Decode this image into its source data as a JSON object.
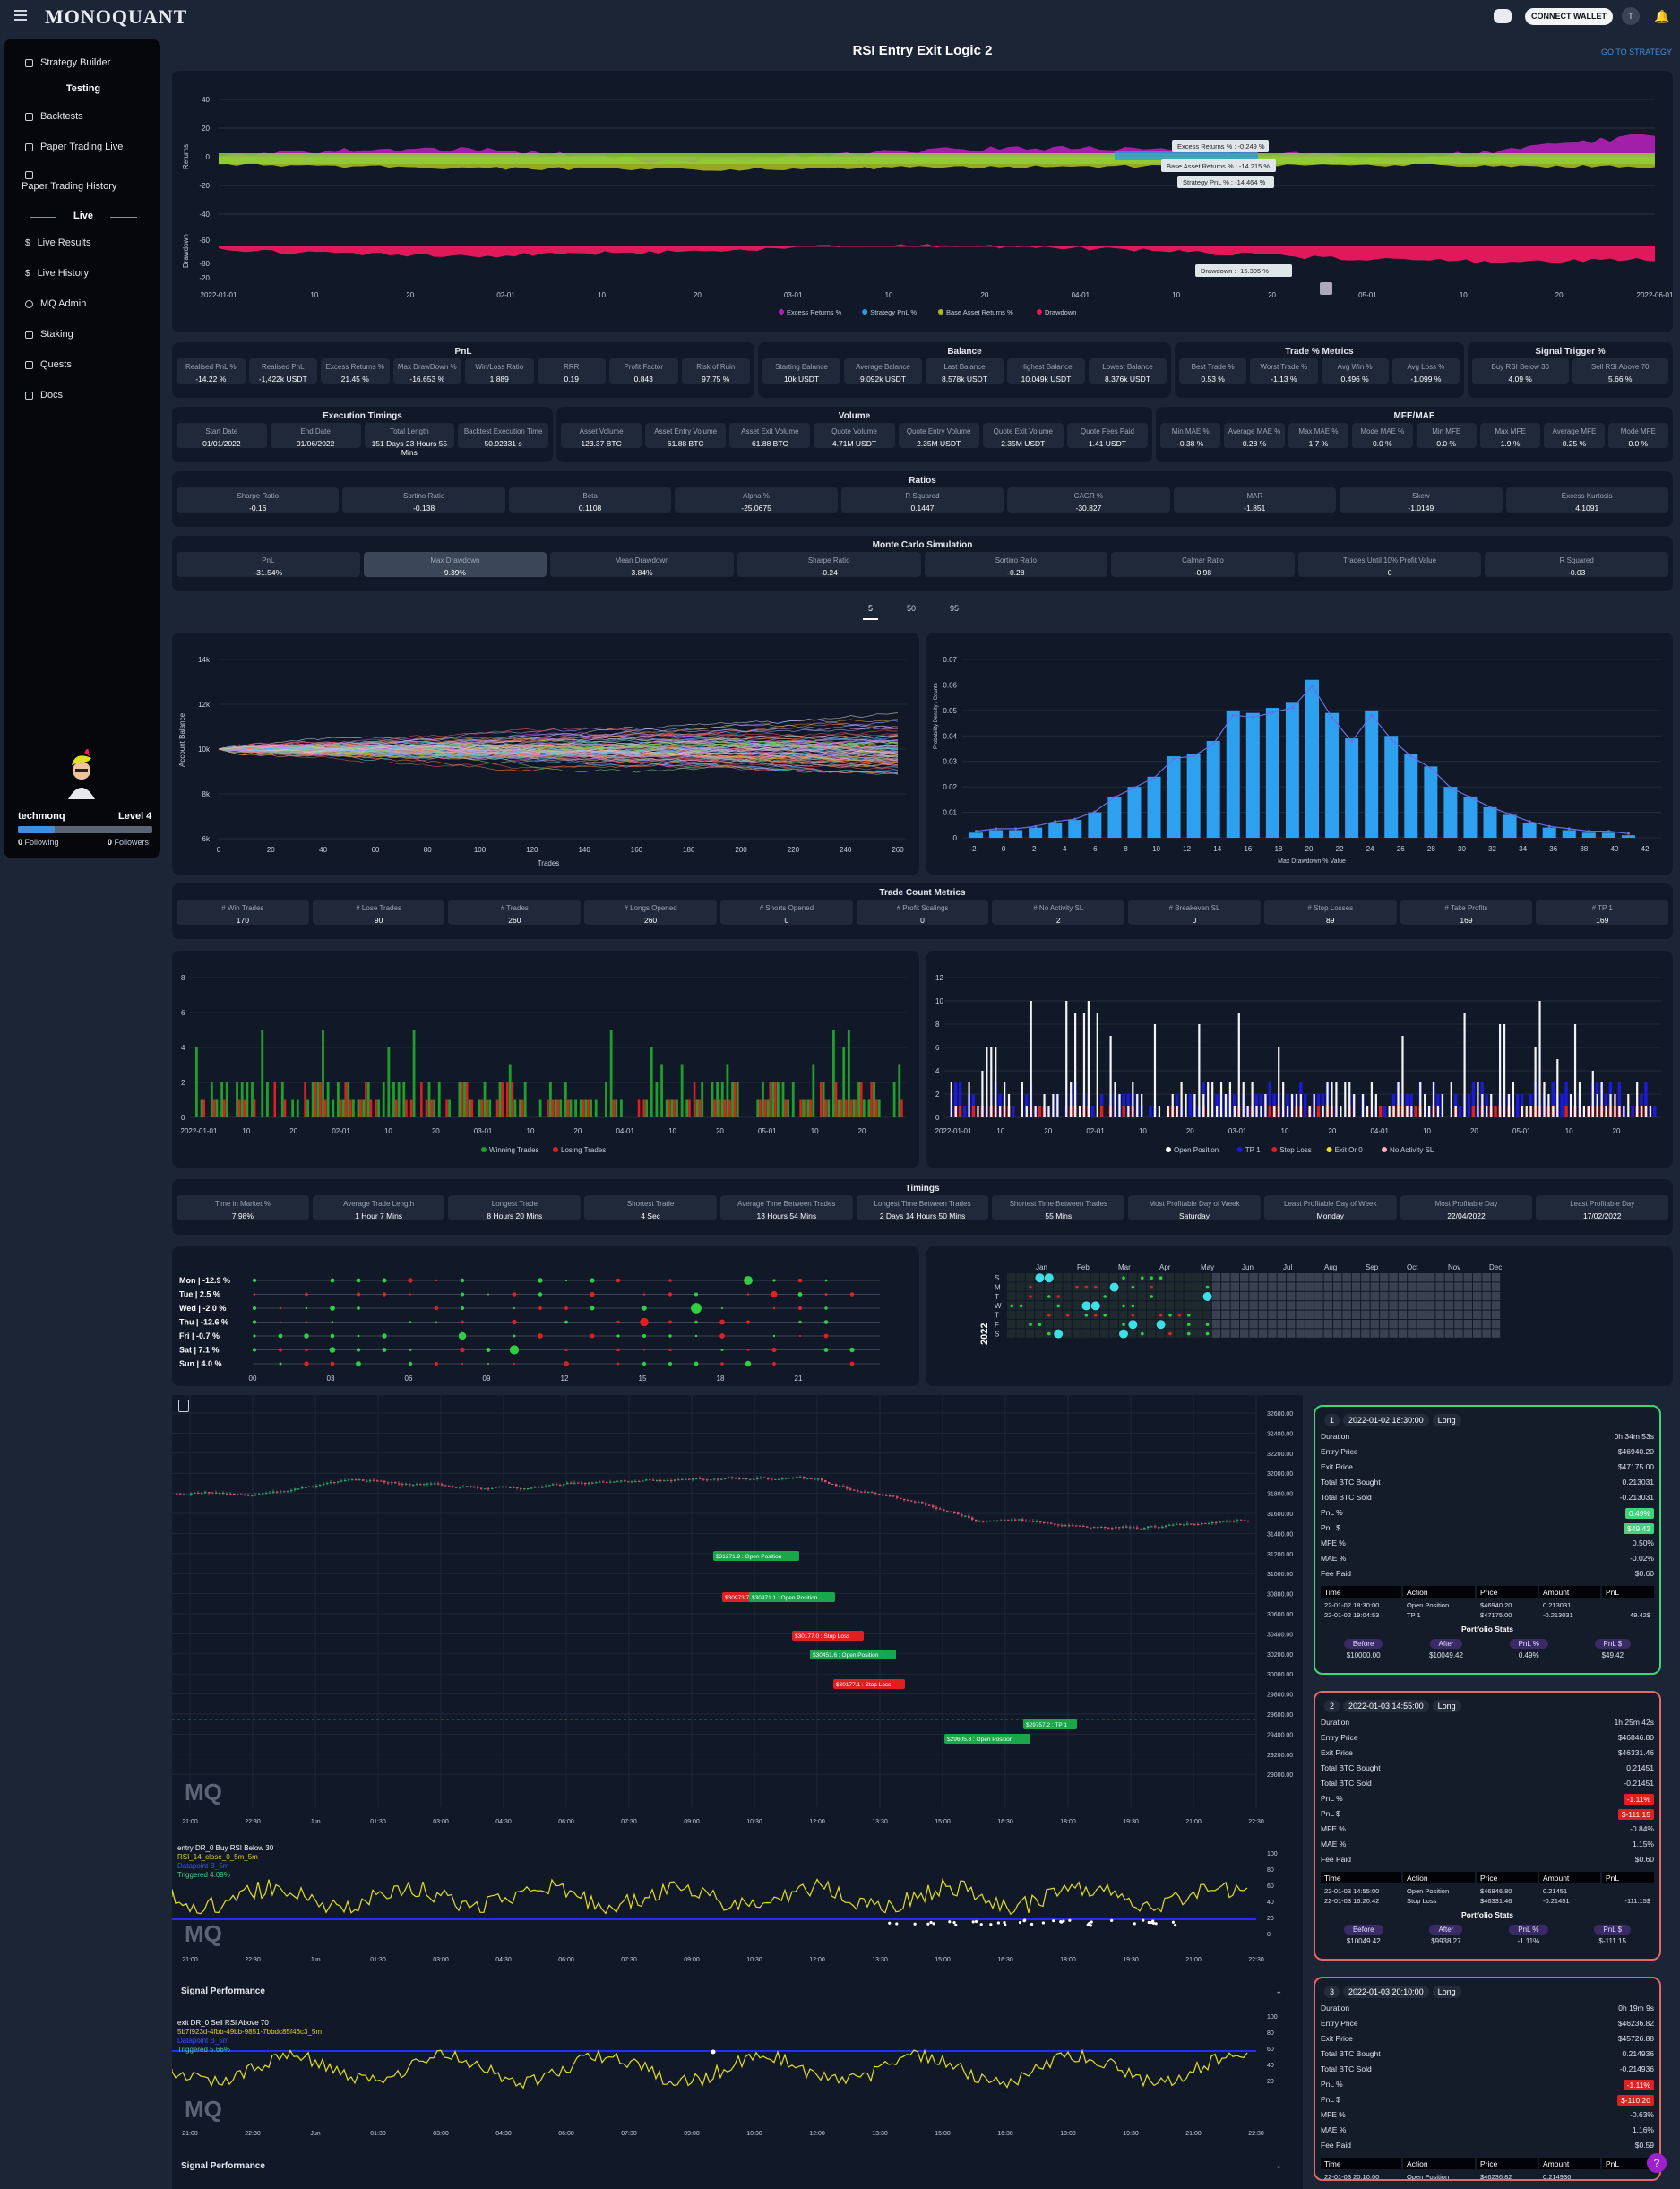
{
  "app": {
    "logo": "MONOQUANT",
    "connect": "CONNECT WALLET",
    "avatar": "T"
  },
  "sidebar": {
    "items": [
      "Strategy Builder",
      "Backtests",
      "Paper Trading Live",
      "Paper Trading History",
      "Live Results",
      "Live History",
      "MQ Admin",
      "Staking",
      "Quests",
      "Docs"
    ],
    "testing": "Testing",
    "live": "Live",
    "user": "techmonq",
    "level": "Level 4",
    "following": "0",
    "following_lbl": "Following",
    "followers": "0",
    "followers_lbl": "Followers",
    "level_progress": 0.27
  },
  "page": {
    "title": "RSI Entry Exit Logic 2",
    "goto": "GO TO STRATEGY"
  },
  "returns_chart": {
    "y_ticks": [
      "40",
      "20",
      "0",
      "-20",
      "-40"
    ],
    "dd_ticks": [
      "-60",
      "-80",
      "-20"
    ],
    "ylabel": "Returns",
    "ddlabel": "Drawdown",
    "x_ticks": [
      "2022-01-01",
      "10",
      "20",
      "02-01",
      "10",
      "20",
      "03-01",
      "10",
      "20",
      "04-01",
      "10",
      "20",
      "05-01",
      "10",
      "20",
      "2022-06-01"
    ],
    "tooltips": [
      "Excess Returns % : -0.249 %",
      "Base Asset Returns % : -14.215 %",
      "Strategy PnL % : -14.464 %",
      "Drawdown : -15.305 %"
    ],
    "legend": [
      "Excess Returns %",
      "Strategy PnL %",
      "Base Asset Returns %",
      "Drawdown"
    ],
    "colors": {
      "excess": "#b320b8",
      "strategy": "#2a9bd8",
      "base": "#a7b821",
      "drawdown": "#e0195a"
    }
  },
  "pnl": {
    "title": "PnL",
    "cards": [
      [
        "Realised PnL %",
        "-14.22 %"
      ],
      [
        "Realised PnL",
        "-1,422k USDT"
      ],
      [
        "Excess Returns %",
        "21.45 %"
      ],
      [
        "Max DrawDown %",
        "-16.653 %"
      ],
      [
        "Win/Loss Ratio",
        "1.889"
      ],
      [
        "RRR",
        "0.19"
      ],
      [
        "Profit Factor",
        "0.843"
      ],
      [
        "Risk of Ruin",
        "97.75 %"
      ]
    ]
  },
  "balance": {
    "title": "Balance",
    "cards": [
      [
        "Starting Balance",
        "10k USDT"
      ],
      [
        "Average Balance",
        "9.092k USDT"
      ],
      [
        "Last Balance",
        "8.578k USDT"
      ],
      [
        "Highest Balance",
        "10.049k USDT"
      ],
      [
        "Lowest Balance",
        "8.376k USDT"
      ]
    ]
  },
  "trade_pct": {
    "title": "Trade % Metrics",
    "cards": [
      [
        "Best Trade %",
        "0.53 %"
      ],
      [
        "Worst Trade %",
        "-1.13 %"
      ],
      [
        "Avg Win %",
        "0.496 %"
      ],
      [
        "Avg Loss %",
        "-1.099 %"
      ]
    ]
  },
  "signal_trigger": {
    "title": "Signal Trigger %",
    "cards": [
      [
        "Buy RSI Below 30",
        "4.09 %"
      ],
      [
        "Sell RSI Above 70",
        "5.66 %"
      ]
    ]
  },
  "exec": {
    "title": "Execution Timings",
    "cards": [
      [
        "Start Date",
        "01/01/2022"
      ],
      [
        "End Date",
        "01/06/2022"
      ],
      [
        "Total Length",
        "151 Days 23 Hours 55 Mins"
      ],
      [
        "Backtest Execution Time",
        "50.92331 s"
      ]
    ]
  },
  "volume": {
    "title": "Volume",
    "cards": [
      [
        "Asset Volume",
        "123.37 BTC"
      ],
      [
        "Asset Entry Volume",
        "61.88 BTC"
      ],
      [
        "Asset Exit Volume",
        "61.88 BTC"
      ],
      [
        "Quote Volume",
        "4.71M USDT"
      ],
      [
        "Quote Entry Volume",
        "2.35M USDT"
      ],
      [
        "Quote Exit Volume",
        "2.35M USDT"
      ],
      [
        "Quote Fees Paid",
        "1.41 USDT"
      ]
    ]
  },
  "mfe": {
    "title": "MFE/MAE",
    "cards": [
      [
        "Min MAE %",
        "-0.38 %"
      ],
      [
        "Average MAE %",
        "0.28 %"
      ],
      [
        "Max MAE %",
        "1.7 %"
      ],
      [
        "Mode MAE %",
        "0.0 %"
      ],
      [
        "Min MFE",
        "0.0 %"
      ],
      [
        "Max MFE",
        "1.9 %"
      ],
      [
        "Average MFE",
        "0.25 %"
      ],
      [
        "Mode MFE",
        "0.0 %"
      ]
    ]
  },
  "ratios": {
    "title": "Ratios",
    "cards": [
      [
        "Sharpe Ratio",
        "-0.16"
      ],
      [
        "Sortino Ratio",
        "-0.138"
      ],
      [
        "Beta",
        "0.1108"
      ],
      [
        "Alpha %",
        "-25.0675"
      ],
      [
        "R Squared",
        "0.1447"
      ],
      [
        "CAGR %",
        "-30.827"
      ],
      [
        "MAR",
        "-1.851"
      ],
      [
        "Skew",
        "-1.0149"
      ],
      [
        "Excess Kurtosis",
        "4.1091"
      ]
    ]
  },
  "monte": {
    "title": "Monte Carlo Simulation",
    "cards": [
      [
        "PnL",
        "-31.54%"
      ],
      [
        "Max Drawdown",
        "9.39%"
      ],
      [
        "Mean Drawdown",
        "3.84%"
      ],
      [
        "Sharpe Ratio",
        "-0.24"
      ],
      [
        "Sortino Ratio",
        "-0.28"
      ],
      [
        "Calmar Ratio",
        "-0.98"
      ],
      [
        "Trades Until 10% Profit Value",
        "0"
      ],
      [
        "R Squared",
        "-0.03"
      ]
    ],
    "tabs": [
      "5",
      "50",
      "95"
    ]
  },
  "mc_lines": {
    "y_ticks": [
      "14k",
      "12k",
      "10k",
      "8k",
      "6k"
    ],
    "x_ticks": [
      "0",
      "20",
      "40",
      "60",
      "80",
      "100",
      "120",
      "140",
      "160",
      "180",
      "200",
      "220",
      "240",
      "260"
    ],
    "ylabel": "Account Balance",
    "xlabel": "Trades"
  },
  "mc_hist": {
    "y_ticks": [
      "0.07",
      "0.06",
      "0.05",
      "0.04",
      "0.03",
      "0.02",
      "0.01",
      "0"
    ],
    "x_ticks": [
      "-2",
      "0",
      "2",
      "4",
      "6",
      "8",
      "10",
      "12",
      "14",
      "16",
      "18",
      "20",
      "22",
      "24",
      "26",
      "28",
      "30",
      "32",
      "34",
      "36",
      "38",
      "40",
      "42"
    ],
    "ylabel": "Probability Density / Counts",
    "xlabel": "Max Drawdown % Value",
    "values": [
      0.002,
      0.003,
      0.003,
      0.004,
      0.006,
      0.007,
      0.01,
      0.016,
      0.02,
      0.024,
      0.032,
      0.033,
      0.038,
      0.05,
      0.049,
      0.051,
      0.053,
      0.062,
      0.049,
      0.039,
      0.05,
      0.04,
      0.033,
      0.028,
      0.02,
      0.016,
      0.012,
      0.009,
      0.006,
      0.004,
      0.003,
      0.002,
      0.002,
      0.001
    ]
  },
  "trade_count": {
    "title": "Trade Count Metrics",
    "cards": [
      [
        "# Win Trades",
        "170"
      ],
      [
        "# Lose Trades",
        "90"
      ],
      [
        "# Trades",
        "260"
      ],
      [
        "# Longs Opened",
        "260"
      ],
      [
        "# Shorts Opened",
        "0"
      ],
      [
        "# Profit Scalings",
        "0"
      ],
      [
        "# No Activity SL",
        "2"
      ],
      [
        "# Breakeven SL",
        "0"
      ],
      [
        "# Stop Losses",
        "89"
      ],
      [
        "# Take Profits",
        "169"
      ],
      [
        "# TP 1",
        "169"
      ]
    ]
  },
  "trades_bar": {
    "y_ticks": [
      "8",
      "6",
      "4",
      "2",
      "0"
    ],
    "x_ticks": [
      "2022-01-01",
      "10",
      "20",
      "02-01",
      "10",
      "20",
      "03-01",
      "10",
      "20",
      "04-01",
      "10",
      "20",
      "05-01",
      "10",
      "20"
    ],
    "legend": [
      "Winning Trades",
      "Losing Trades"
    ],
    "colors": [
      "#1f9e2c",
      "#e02020"
    ]
  },
  "types_bar": {
    "y_ticks": [
      "12",
      "10",
      "8",
      "6",
      "4",
      "2",
      "0"
    ],
    "x_ticks": [
      "2022-01-01",
      "10",
      "20",
      "02-01",
      "10",
      "20",
      "03-01",
      "10",
      "20",
      "04-01",
      "10",
      "20",
      "05-01",
      "10",
      "20"
    ],
    "legend": [
      "Open Position",
      "TP 1",
      "Stop Loss",
      "Exit Or 0",
      "No Activity SL"
    ],
    "colors": [
      "#ffffff",
      "#1a1ad8",
      "#e02020",
      "#f0e020",
      "#ffb0b0"
    ]
  },
  "timings": {
    "title": "Timings",
    "cards": [
      [
        "Time in Market %",
        "7.98%"
      ],
      [
        "Average Trade Length",
        "1 Hour 7 Mins"
      ],
      [
        "Longest Trade",
        "8 Hours 20 Mins"
      ],
      [
        "Shortest Trade",
        "4 Sec"
      ],
      [
        "Average Time Between Trades",
        "13 Hours 54 Mins"
      ],
      [
        "Longest Time Between Trades",
        "2 Days 14 Hours 50 Mins"
      ],
      [
        "Shortest Time Between Trades",
        "55 Mins"
      ],
      [
        "Most Profitable Day of Week",
        "Saturday"
      ],
      [
        "Least Profitable Day of Week",
        "Monday"
      ],
      [
        "Most Profitable Day",
        "22/04/2022"
      ],
      [
        "Least Profitable Day",
        "17/02/2022"
      ]
    ]
  },
  "weekday": {
    "rows": [
      "Mon | -12.9 %",
      "Tue | 2.5 %",
      "Wed | -2.0 %",
      "Thu | -12.6 %",
      "Fri | -0.7 %",
      "Sat | 7.1 %",
      "Sun | 4.0 %"
    ],
    "x_ticks": [
      "00",
      "03",
      "06",
      "09",
      "12",
      "15",
      "18",
      "21"
    ]
  },
  "calendar": {
    "months": [
      "Jan",
      "Feb",
      "Mar",
      "Apr",
      "May",
      "Jun",
      "Jul",
      "Aug",
      "Sep",
      "Oct",
      "Nov",
      "Dec"
    ],
    "days": [
      "S",
      "M",
      "T",
      "W",
      "T",
      "F",
      "S"
    ],
    "year": "2022"
  },
  "price": {
    "y_ticks": [
      "32600.00",
      "32400.00",
      "32200.00",
      "32000.00",
      "31800.00",
      "31600.00",
      "31400.00",
      "31200.00",
      "31000.00",
      "30800.00",
      "30600.00",
      "30400.00",
      "30200.00",
      "30000.00",
      "29800.00",
      "29600.00",
      "29400.00",
      "29200.00",
      "29000.00"
    ],
    "x_ticks": [
      "21:00",
      "22:30",
      "Jun",
      "01:30",
      "03:00",
      "04:30",
      "06:00",
      "07:30",
      "09:00",
      "10:30",
      "12:00",
      "13:30",
      "15:00",
      "16:30",
      "18:00",
      "19:30",
      "21:00",
      "22:30"
    ],
    "markers": [
      "$31271.9 : Open Position",
      "$30973.7 : Open Position",
      "$30971.1 : Open Position",
      "$30177.0 : Stop Loss",
      "$30451.6 : Open Position",
      "$30177.1 : Stop Loss",
      "$29757.2 : TP 1",
      "$29605.8 : Open Position"
    ]
  },
  "ind1": {
    "lines": [
      "entry DR_0 Buy RSI Below 30",
      "RSI_14_close_0_5m_5m",
      "Datapoint B_5m",
      "Triggered 4.09%"
    ],
    "y_ticks": [
      "100",
      "80",
      "60",
      "40",
      "20",
      "0"
    ]
  },
  "ind2": {
    "lines": [
      "exit DR_0 Sell RSI Above 70",
      "5b7f923d-4fbb-49bb-9851-7bbdc85f46c3_5m",
      "Datapoint B_5m",
      "Triggered 5.66%"
    ],
    "y_ticks": [
      "100",
      "80",
      "60",
      "40",
      "20"
    ]
  },
  "signal_perf": "Signal Performance",
  "trades": [
    {
      "n": "1",
      "date": "2022-01-02 18:30:00",
      "side": "Long",
      "color": "#3ed57a",
      "rows": [
        [
          "Duration",
          "0h 34m 53s"
        ],
        [
          "Entry Price",
          "$46940.20"
        ],
        [
          "Exit Price",
          "$47175.00"
        ],
        [
          "Total BTC Bought",
          "0.213031"
        ],
        [
          "Total BTC Sold",
          "-0.213031"
        ],
        [
          "PnL %",
          "0.49%"
        ],
        [
          "PnL $",
          "$49.42"
        ],
        [
          "MFE %",
          "0.50%"
        ],
        [
          "MAE %",
          "-0.02%"
        ],
        [
          "Fee Paid",
          "$0.60"
        ]
      ],
      "table": [
        [
          "22-01-02 18:30:00",
          "Open Position",
          "$46940.20",
          "0.213031",
          ""
        ],
        [
          "22-01-02 19:04:53",
          "TP 1",
          "$47175.00",
          "-0.213031",
          "49.42$"
        ]
      ],
      "before": "$10000.00",
      "after": "$10049.42",
      "pnlp": "0.49%",
      "pnld": "$49.42"
    },
    {
      "n": "2",
      "date": "2022-01-03 14:55:00",
      "side": "Long",
      "color": "#e06a6a",
      "rows": [
        [
          "Duration",
          "1h 25m 42s"
        ],
        [
          "Entry Price",
          "$46846.80"
        ],
        [
          "Exit Price",
          "$46331.46"
        ],
        [
          "Total BTC Bought",
          "0.21451"
        ],
        [
          "Total BTC Sold",
          "-0.21451"
        ],
        [
          "PnL %",
          "-1.11%"
        ],
        [
          "PnL $",
          "$-111.15"
        ],
        [
          "MFE %",
          "-0.84%"
        ],
        [
          "MAE %",
          "1.15%"
        ],
        [
          "Fee Paid",
          "$0.60"
        ]
      ],
      "table": [
        [
          "22-01-03 14:55:00",
          "Open Position",
          "$46846.80",
          "0.21451",
          ""
        ],
        [
          "22-01-03 16:20:42",
          "Stop Loss",
          "$46331.46",
          "-0.21451",
          "-111.15$"
        ]
      ],
      "before": "$10049.42",
      "after": "$9938.27",
      "pnlp": "-1.11%",
      "pnld": "$-111.15"
    },
    {
      "n": "3",
      "date": "2022-01-03 20:10:00",
      "side": "Long",
      "color": "#e06a6a",
      "rows": [
        [
          "Duration",
          "0h 19m 9s"
        ],
        [
          "Entry Price",
          "$46236.82"
        ],
        [
          "Exit Price",
          "$45726.88"
        ],
        [
          "Total BTC Bought",
          "0.214936"
        ],
        [
          "Total BTC Sold",
          "-0.214936"
        ],
        [
          "PnL %",
          "-1.11%"
        ],
        [
          "PnL $",
          "$-110.20"
        ],
        [
          "MFE %",
          "-0.63%"
        ],
        [
          "MAE %",
          "1.16%"
        ],
        [
          "Fee Paid",
          "$0.59"
        ]
      ],
      "table": [
        [
          "22-01-03 20:10:00",
          "Open Position",
          "$46236.82",
          "0.214936",
          ""
        ]
      ],
      "before": "",
      "after": "",
      "pnlp": "",
      "pnld": ""
    }
  ],
  "table_headers": [
    "Time",
    "Action",
    "Price",
    "Amount",
    "PnL"
  ],
  "portfolio_stats": "Portfolio Stats",
  "portfolio_cols": [
    "Before",
    "After",
    "PnL %",
    "PnL $"
  ]
}
